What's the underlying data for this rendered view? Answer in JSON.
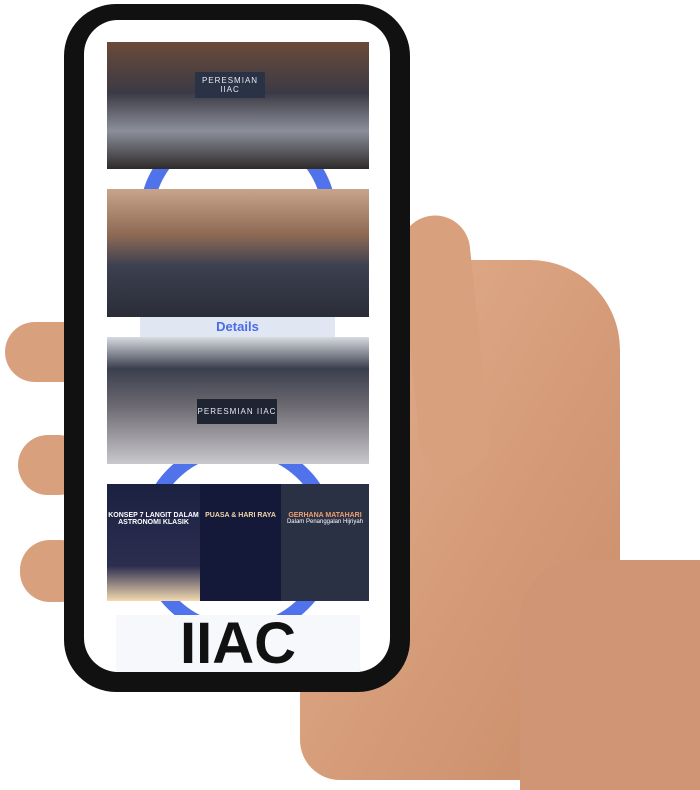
{
  "screen": {
    "photos": [
      {
        "caption": "PERESMIAN IIAC"
      },
      {
        "caption": ""
      },
      {
        "caption": "PERESMIAN IIAC"
      }
    ],
    "details_label": "Details",
    "posters": [
      {
        "title": "KONSEP 7 LANGIT DALAM ASTRONOMI KLASIK"
      },
      {
        "title": "PUASA & HARI RAYA"
      },
      {
        "title": "GERHANA MATAHARI",
        "subtitle": "Dalam Penanggalan Hijriyah"
      }
    ],
    "brand": "IIAC"
  },
  "colors": {
    "accent": "#3d63e8",
    "skin": "#d9a07e",
    "phone": "#111111"
  }
}
